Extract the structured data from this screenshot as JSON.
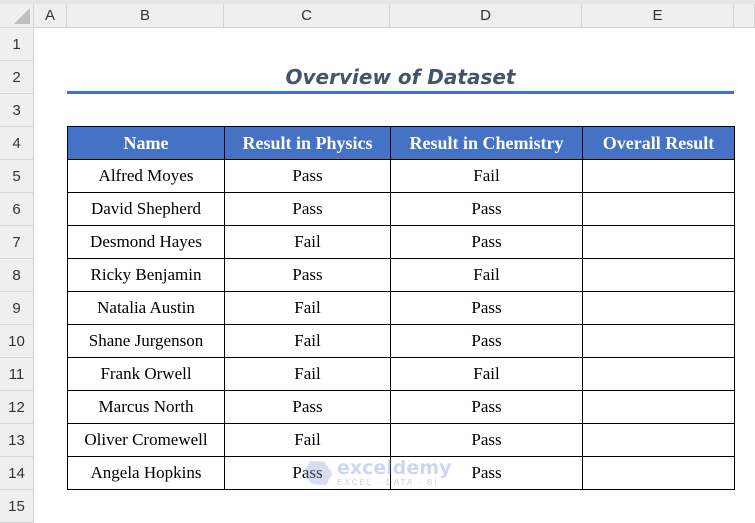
{
  "columns": [
    "A",
    "B",
    "C",
    "D",
    "E"
  ],
  "rows": [
    "1",
    "2",
    "3",
    "4",
    "5",
    "6",
    "7",
    "8",
    "9",
    "10",
    "11",
    "12",
    "13",
    "14",
    "15"
  ],
  "title": "Overview of Dataset",
  "headers": [
    "Name",
    "Result in Physics",
    "Result in Chemistry",
    "Overall Result"
  ],
  "data": [
    [
      "Alfred Moyes",
      "Pass",
      "Fail",
      ""
    ],
    [
      "David Shepherd",
      "Pass",
      "Pass",
      ""
    ],
    [
      "Desmond Hayes",
      "Fail",
      "Pass",
      ""
    ],
    [
      "Ricky Benjamin",
      "Pass",
      "Fail",
      ""
    ],
    [
      "Natalia Austin",
      "Fail",
      "Pass",
      ""
    ],
    [
      "Shane Jurgenson",
      "Fail",
      "Pass",
      ""
    ],
    [
      "Frank Orwell",
      "Fail",
      "Fail",
      ""
    ],
    [
      "Marcus North",
      "Pass",
      "Pass",
      ""
    ],
    [
      "Oliver Cromewell",
      "Fail",
      "Pass",
      ""
    ],
    [
      "Angela Hopkins",
      "Pass",
      "Pass",
      ""
    ]
  ],
  "watermark": {
    "name": "exceldemy",
    "tagline": "EXCEL · DATA · BI"
  }
}
